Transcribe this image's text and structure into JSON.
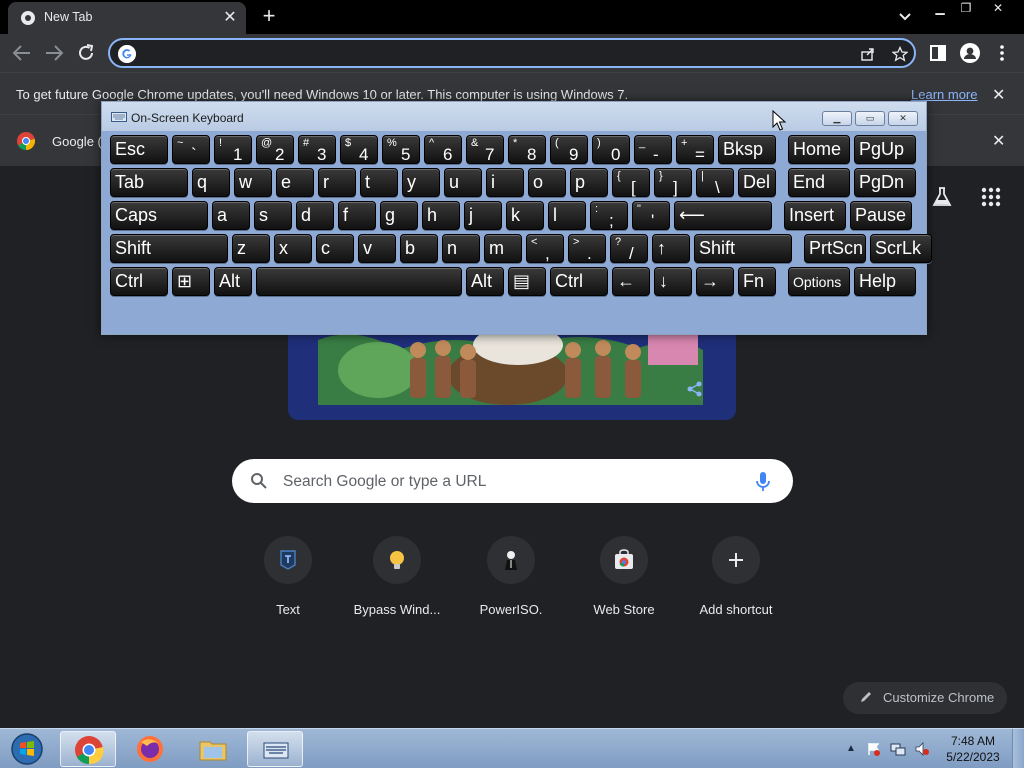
{
  "browser": {
    "tab": {
      "title": "New Tab",
      "favicon": "chrome-icon",
      "close": "✕"
    },
    "new_tab": "+",
    "window_controls": {
      "minimize": "▁",
      "restore": "❐",
      "close": "✕"
    },
    "omnibox": {
      "value": "",
      "placeholder": ""
    }
  },
  "infobar": {
    "message": "To get future Google Chrome updates, you'll need Windows 10 or later. This computer is using Windows 7.",
    "link": "Learn more",
    "close": "✕"
  },
  "infobar2": {
    "message": "Google (",
    "close": "✕"
  },
  "ntp": {
    "search_placeholder": "Search Google or type a URL",
    "shortcuts": [
      {
        "label": "Text",
        "icon": "text-app-icon"
      },
      {
        "label": "Bypass Wind...",
        "icon": "lightbulb-icon"
      },
      {
        "label": "PowerISO.",
        "icon": "poweriso-icon"
      },
      {
        "label": "Web Store",
        "icon": "web-store-icon"
      },
      {
        "label": "Add shortcut",
        "icon": "plus-icon"
      }
    ],
    "customize_label": "Customize Chrome"
  },
  "osk": {
    "title": "On-Screen Keyboard",
    "rows": [
      [
        {
          "main": "Esc"
        },
        {
          "top": "~",
          "bot": "`"
        },
        {
          "top": "!",
          "bot": "1"
        },
        {
          "top": "@",
          "bot": "2"
        },
        {
          "top": "#",
          "bot": "3"
        },
        {
          "top": "$",
          "bot": "4"
        },
        {
          "top": "%",
          "bot": "5"
        },
        {
          "top": "^",
          "bot": "6"
        },
        {
          "top": "&",
          "bot": "7"
        },
        {
          "top": "*",
          "bot": "8"
        },
        {
          "top": "(",
          "bot": "9"
        },
        {
          "top": ")",
          "bot": "0"
        },
        {
          "top": "_",
          "bot": "-"
        },
        {
          "top": "+",
          "bot": "="
        },
        {
          "main": "Bksp"
        },
        {
          "main": "Home"
        },
        {
          "main": "PgUp"
        }
      ],
      [
        {
          "main": "Tab"
        },
        {
          "main": "q"
        },
        {
          "main": "w"
        },
        {
          "main": "e"
        },
        {
          "main": "r"
        },
        {
          "main": "t"
        },
        {
          "main": "y"
        },
        {
          "main": "u"
        },
        {
          "main": "i"
        },
        {
          "main": "o"
        },
        {
          "main": "p"
        },
        {
          "top": "{",
          "bot": "["
        },
        {
          "top": "}",
          "bot": "]"
        },
        {
          "top": "|",
          "bot": "\\"
        },
        {
          "main": "Del"
        },
        {
          "main": "End"
        },
        {
          "main": "PgDn"
        }
      ],
      [
        {
          "main": "Caps"
        },
        {
          "main": "a"
        },
        {
          "main": "s"
        },
        {
          "main": "d"
        },
        {
          "main": "f"
        },
        {
          "main": "g"
        },
        {
          "main": "h"
        },
        {
          "main": "j"
        },
        {
          "main": "k"
        },
        {
          "main": "l"
        },
        {
          "top": ":",
          "bot": ";"
        },
        {
          "top": "\"",
          "bot": "'"
        },
        {
          "main": "⟵"
        },
        {
          "main": "Insert"
        },
        {
          "main": "Pause"
        }
      ],
      [
        {
          "main": "Shift"
        },
        {
          "main": "z"
        },
        {
          "main": "x"
        },
        {
          "main": "c"
        },
        {
          "main": "v"
        },
        {
          "main": "b"
        },
        {
          "main": "n"
        },
        {
          "main": "m"
        },
        {
          "top": "<",
          "bot": ","
        },
        {
          "top": ">",
          "bot": "."
        },
        {
          "top": "?",
          "bot": "/"
        },
        {
          "main": "↑"
        },
        {
          "main": "Shift"
        },
        {
          "main": "PrtScn"
        },
        {
          "main": "ScrLk"
        }
      ],
      [
        {
          "main": "Ctrl"
        },
        {
          "main": "⊞"
        },
        {
          "main": "Alt"
        },
        {
          "main": ""
        },
        {
          "main": "Alt"
        },
        {
          "main": "▤"
        },
        {
          "main": "Ctrl"
        },
        {
          "main": "←"
        },
        {
          "main": "↓"
        },
        {
          "main": "→"
        },
        {
          "main": "Fn"
        },
        {
          "small": "Options"
        },
        {
          "main": "Help"
        }
      ]
    ]
  },
  "taskbar": {
    "apps": [
      "chrome-icon",
      "firefox-icon",
      "explorer-folder-icon",
      "osk-icon"
    ],
    "active_app": "chrome-icon",
    "clock": {
      "time": "7:48 AM",
      "date": "5/22/2023"
    },
    "tray_up": "▲"
  },
  "colors": {
    "accent": "#8ab4f8",
    "ntp_background": "#202124",
    "toolbar": "#35363a"
  }
}
